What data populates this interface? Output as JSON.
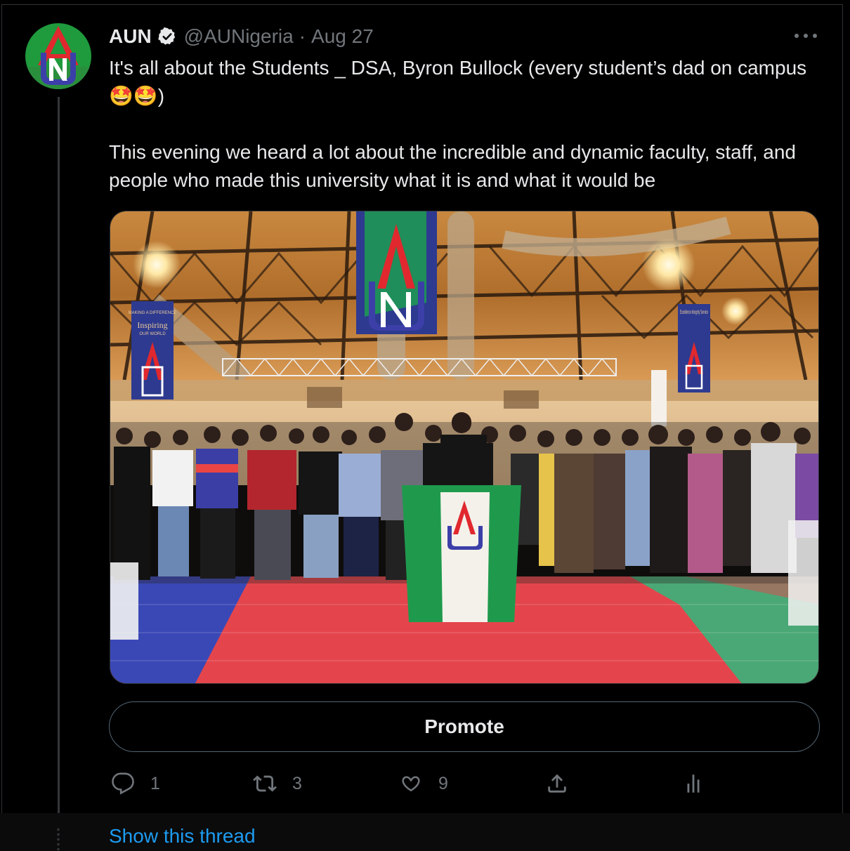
{
  "tweet": {
    "author_name": "AUN",
    "handle": "@AUNigeria",
    "separator": "·",
    "date": "Aug 27",
    "text_line1": "It's all about the Students _ DSA, Byron Bullock (every student’s dad on campus 🤩🤩)",
    "text_line2": "This evening we heard a lot about the incredible and dynamic faculty, staff, and people who made this university what it is and what it would be"
  },
  "avatar": {
    "logo_text": "AUN"
  },
  "media": {
    "banner_left_text": "Inspiring",
    "banner_left_small": "MAKING A DIFFERENCE",
    "banner_left_small2": "OUR WORLD",
    "banner_right_text": "Excellence Integrity Service",
    "logo_text": "AUN"
  },
  "promote_label": "Promote",
  "actions": {
    "reply_count": "1",
    "retweet_count": "3",
    "like_count": "9"
  },
  "show_thread_label": "Show this thread",
  "colors": {
    "link": "#1d9bf0",
    "muted": "#71767b",
    "text": "#e7e9ea",
    "background": "#000000"
  }
}
